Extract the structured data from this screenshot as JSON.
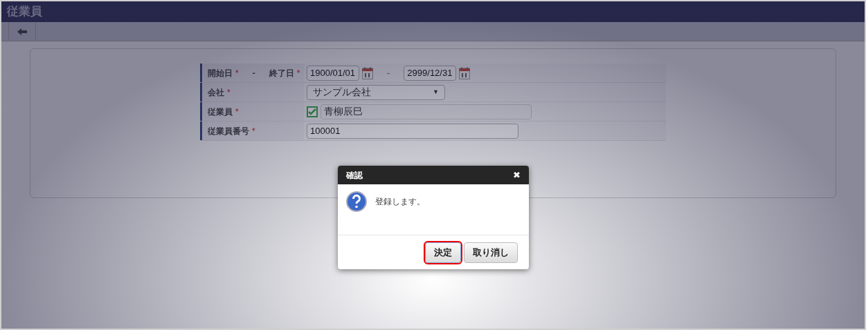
{
  "window": {
    "title": "従業員"
  },
  "form": {
    "rows": [
      {
        "kind": "date_range",
        "labels": [
          {
            "text": "開始日",
            "required": true
          },
          {
            "text": "終了日",
            "required": true
          }
        ],
        "separator": "-",
        "values": [
          "1900/01/01",
          "2999/12/31"
        ],
        "range_separator": "-"
      },
      {
        "kind": "select",
        "labels": [
          {
            "text": "会社",
            "required": true
          }
        ],
        "value": "サンプル会社",
        "caret": "▼"
      },
      {
        "kind": "employee",
        "labels": [
          {
            "text": "従業員",
            "required": true
          }
        ],
        "checked": true,
        "value": "青柳辰巳"
      },
      {
        "kind": "text",
        "labels": [
          {
            "text": "従業員番号",
            "required": true
          }
        ],
        "value": "100001"
      }
    ],
    "required_mark": "*"
  },
  "dialog": {
    "title": "確認",
    "close": "✖",
    "message": "登録します。",
    "buttons": [
      {
        "label": "決定",
        "focused": true
      },
      {
        "label": "取り消し",
        "focused": false
      }
    ]
  }
}
